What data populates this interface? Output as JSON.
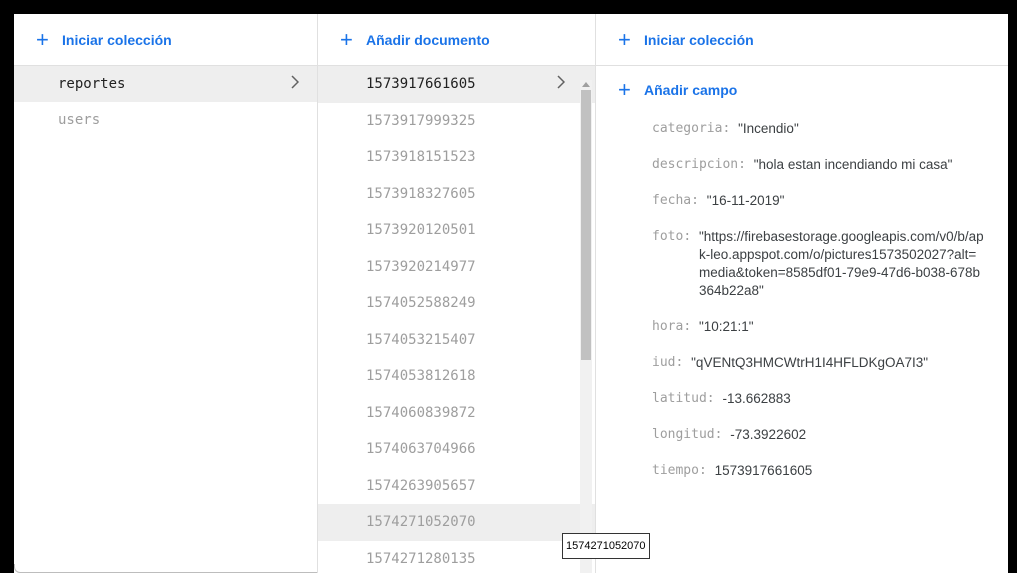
{
  "collections_panel": {
    "header_label": "Iniciar colección",
    "items": [
      {
        "label": "reportes",
        "selected": true
      },
      {
        "label": "users",
        "selected": false
      }
    ]
  },
  "documents_panel": {
    "header_label": "Añadir documento",
    "items": [
      "1573917661605",
      "1573917999325",
      "1573918151523",
      "1573918327605",
      "1573920120501",
      "1573920214977",
      "1574052588249",
      "1574053215407",
      "1574053812618",
      "1574060839872",
      "1574063704966",
      "1574263905657",
      "1574271052070",
      "1574271280135"
    ],
    "selected_index": 0,
    "hover_index": 12
  },
  "document_panel": {
    "header_label": "Iniciar colección",
    "add_field_label": "Añadir campo",
    "fields": [
      {
        "key": "categoria",
        "value": "\"Incendio\""
      },
      {
        "key": "descripcion",
        "value": "\"hola estan incendiando mi casa\""
      },
      {
        "key": "fecha",
        "value": "\"16-11-2019\""
      },
      {
        "key": "foto",
        "value": "\"https://firebasestorage.googleapis.com/v0/b/apk-leo.appspot.com/o/pictures1573502027?alt=media&token=8585df01-79e9-47d6-b038-678b364b22a8\""
      },
      {
        "key": "hora",
        "value": "\"10:21:1\""
      },
      {
        "key": "iud",
        "value": "\"qVENtQ3HMCWtrH1I4HFLDKgOA7I3\""
      },
      {
        "key": "latitud",
        "value": "-13.662883"
      },
      {
        "key": "longitud",
        "value": "-73.3922602"
      },
      {
        "key": "tiempo",
        "value": "1573917661605"
      }
    ]
  },
  "tooltip": "1574271052070",
  "colors": {
    "accent": "#1a73e8",
    "selected_bg": "#eeeeee",
    "muted_text": "#9e9e9e"
  }
}
